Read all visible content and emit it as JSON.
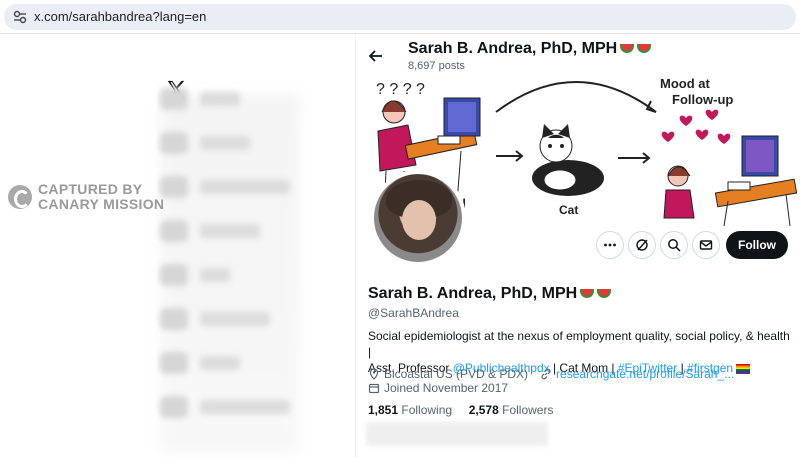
{
  "browser": {
    "url": "x.com/sarahbandrea?lang=en"
  },
  "watermark": {
    "line1": "CAPTURED BY",
    "line2": "CANARY MISSION"
  },
  "header": {
    "name": "Sarah B. Andrea, PhD, MPH",
    "posts": "8,697 posts"
  },
  "banner": {
    "label_mood": "Mood at",
    "label_follow": "Follow-up",
    "label_cat": "Cat",
    "label_d": "d"
  },
  "profile": {
    "name": "Sarah B. Andrea, PhD, MPH",
    "handle": "@SarahBAndrea",
    "bio_line1": "Social epidemiologist at the nexus of employment quality, social policy, & health |",
    "bio_pre": "Asst. Professor ",
    "bio_link1": "@Publichealthpdx",
    "bio_mid": " | Cat Mom | ",
    "bio_link2": "#EpiTwitter",
    "bio_sep": " | ",
    "bio_link3": "#firstgen",
    "location": "Bicoastal US (PVD & PDX)",
    "website": "researchgate.net/profile/Sarah_...",
    "joined": "Joined November 2017",
    "following_count": "1,851",
    "following_label": "Following",
    "followers_count": "2,578",
    "followers_label": "Followers"
  },
  "actions": {
    "follow": "Follow"
  },
  "icons": [
    "tune-icon",
    "x-logo-icon",
    "back-arrow-icon",
    "more-icon",
    "grok-icon",
    "search-icon",
    "mail-icon",
    "location-icon",
    "link-icon",
    "calendar-icon",
    "watermelon-icon"
  ],
  "colors": {
    "accent": "#1d9bf0",
    "follow_bg": "#0f1419"
  }
}
